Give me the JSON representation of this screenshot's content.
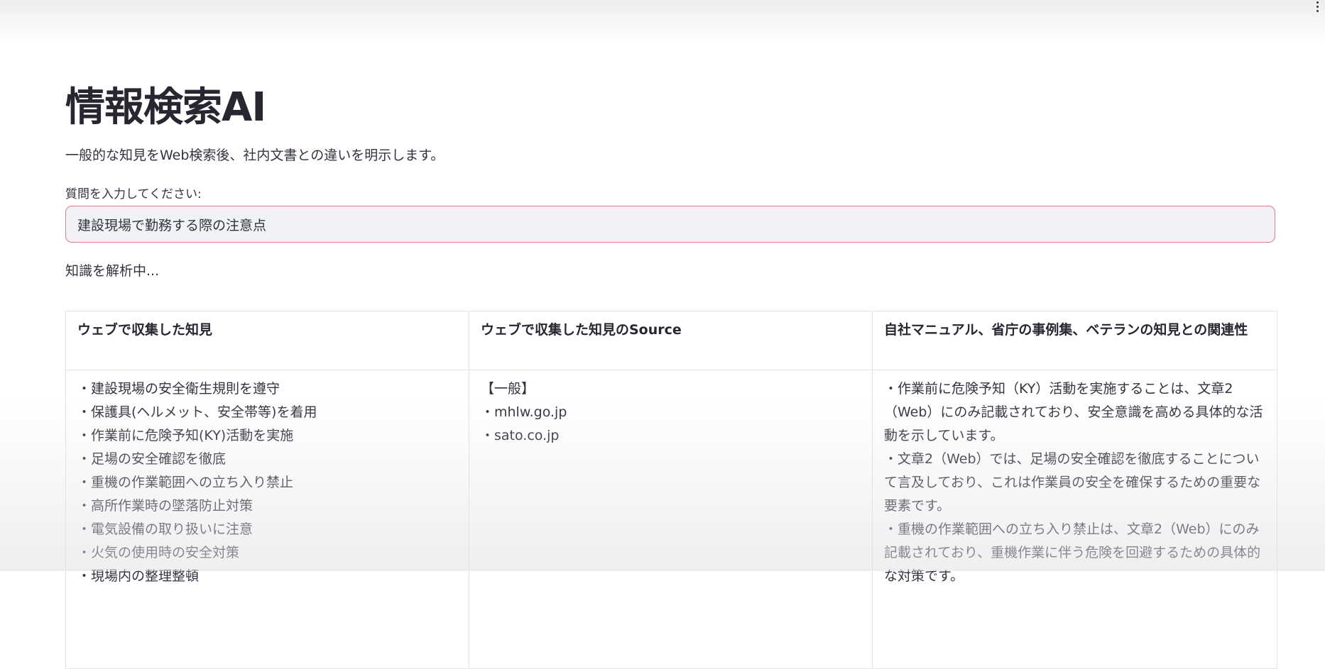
{
  "header": {
    "menu_icon": "vertical-ellipsis-icon"
  },
  "page": {
    "title": "情報検索AI",
    "subtitle": "一般的な知見をWeb検索後、社内文書との違いを明示します。",
    "input_label": "質問を入力してください:",
    "input_value": "建設現場で勤務する際の注意点",
    "status": "知識を解析中..."
  },
  "table": {
    "headers": [
      "ウェブで収集した知見",
      "ウェブで収集した知見のSource",
      "自社マニュアル、省庁の事例集、ベテランの知見との関連性"
    ],
    "web_findings": [
      "・建設現場の安全衛生規則を遵守",
      "・保護具(ヘルメット、安全帯等)を着用",
      "・作業前に危険予知(KY)活動を実施",
      "・足場の安全確認を徹底",
      "・重機の作業範囲への立ち入り禁止",
      "・高所作業時の墜落防止対策",
      "・電気設備の取り扱いに注意",
      "・火気の使用時の安全対策",
      "・現場内の整理整頓"
    ],
    "sources": [
      "【一般】",
      "・mhlw.go.jp",
      "・sato.co.jp"
    ],
    "relevance": [
      "・作業前に危険予知（KY）活動を実施することは、文章2（Web）にのみ記載されており、安全意識を高める具体的な活動を示しています。",
      "・文章2（Web）では、足場の安全確認を徹底することについて言及しており、これは作業員の安全を確保するための重要な要素です。",
      "・重機の作業範囲への立ち入り禁止は、文章2（Web）にのみ記載されており、重機作業に伴う危険を回避するための具体的な対策です。"
    ]
  }
}
